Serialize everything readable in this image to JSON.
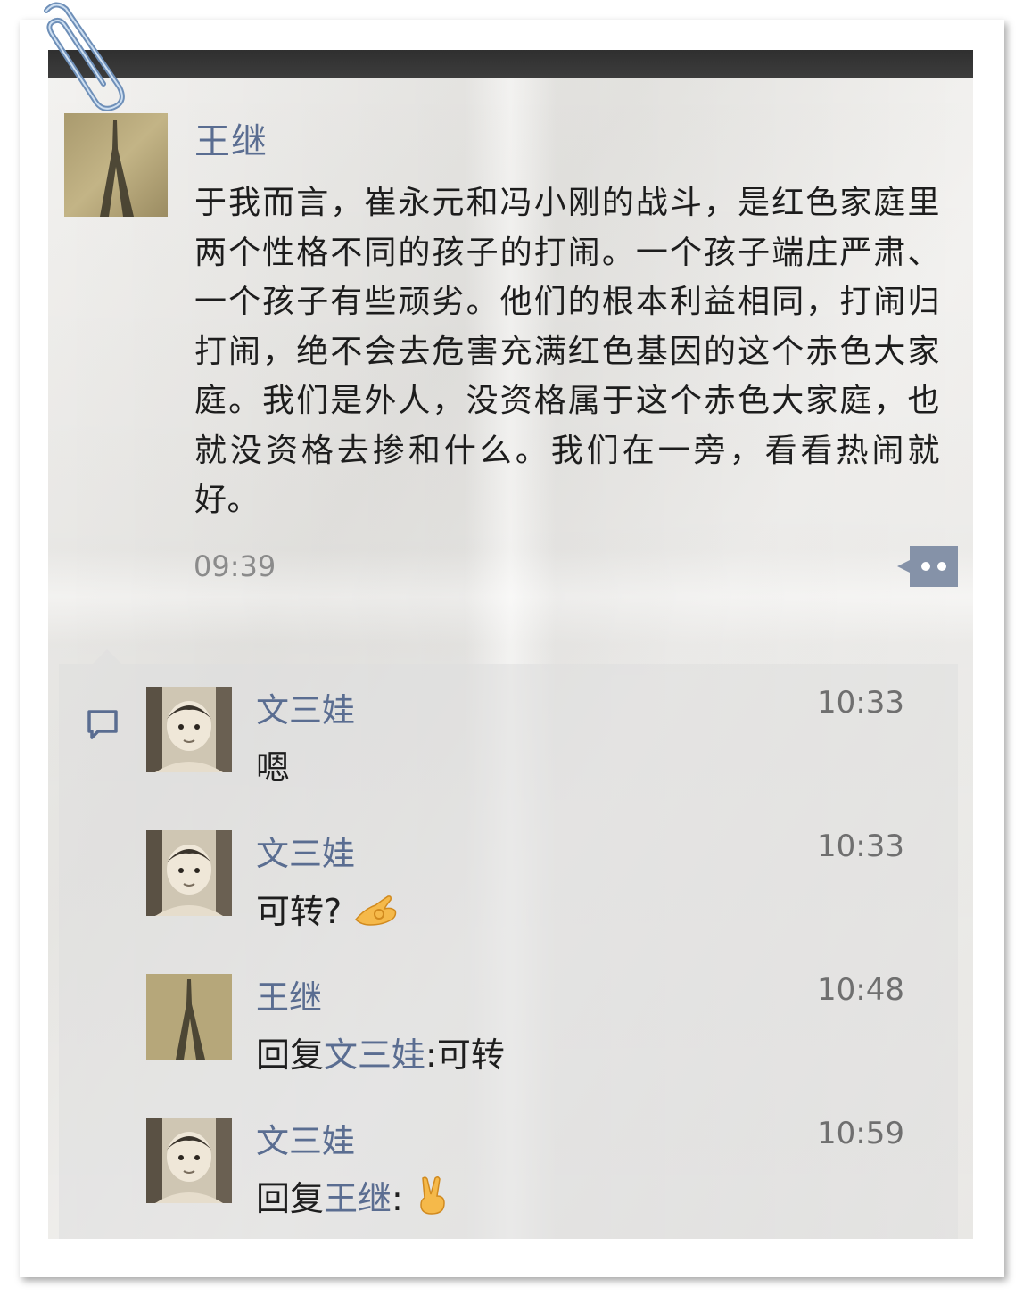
{
  "post": {
    "author": "王继",
    "text": "于我而言，崔永元和冯小刚的战斗，是红色家庭里两个性格不同的孩子的打闹。一个孩子端庄严肃、一个孩子有些顽劣。他们的根本利益相同，打闹归打闹，绝不会去危害充满红色基因的这个赤色大家庭。我们是外人，没资格属于这个赤色大家庭，也就没资格去掺和什么。我们在一旁，看看热闹就好。",
    "time": "09:39"
  },
  "comments": [
    {
      "author": "文三娃",
      "time": "10:33",
      "text": "嗯"
    },
    {
      "author": "文三娃",
      "time": "10:33",
      "text": "可转?",
      "emoji": "ok-hand-emoji"
    },
    {
      "author": "王继",
      "time": "10:48",
      "reply_prefix": "回复",
      "reply_to": "文三娃",
      "reply_text": ":可转"
    },
    {
      "author": "文三娃",
      "time": "10:59",
      "reply_prefix": "回复",
      "reply_to": "王继",
      "reply_text": ":",
      "emoji": "victory-hand-emoji"
    }
  ],
  "colors": {
    "name": "#5a6d91",
    "text": "#1d1d1d",
    "time": "#8b8b8b",
    "paper": "#f1f0ee",
    "comment_bg": "#dedede"
  },
  "icons": {
    "more": "more-dots-icon",
    "comment": "comment-bubble-icon",
    "clip": "paperclip-icon"
  }
}
